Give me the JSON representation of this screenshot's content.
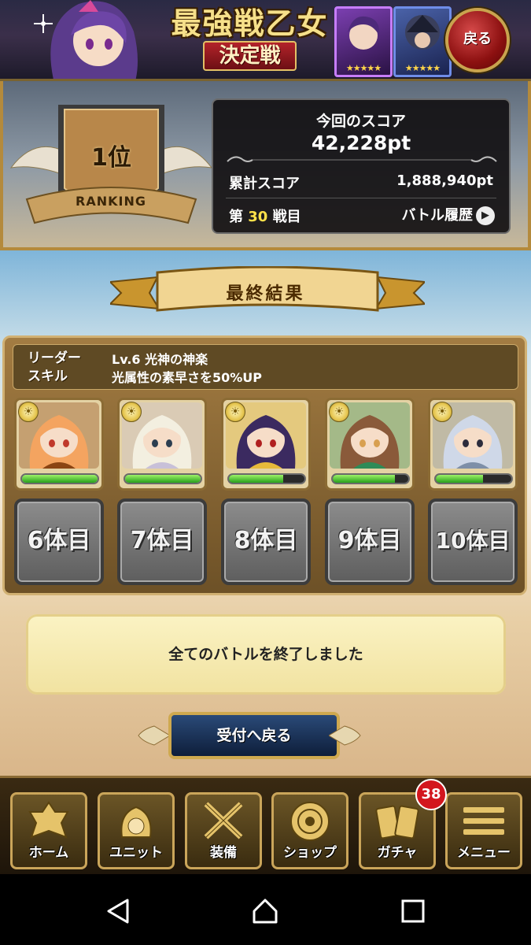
{
  "header": {
    "title_line1": "最強戦乙女",
    "title_line2": "決定戦",
    "back_label": "戻る",
    "card_stars": "★★★★★"
  },
  "rank": {
    "position": "1位",
    "emblem_label": "RANKING"
  },
  "score": {
    "title": "今回のスコア",
    "current": "42,228pt",
    "total_label": "累計スコア",
    "total_value": "1,888,940pt",
    "battle_prefix": "第",
    "battle_number": "30",
    "battle_suffix": "戦目",
    "history_label": "バトル履歴"
  },
  "result": {
    "ribbon_label": "最終結果"
  },
  "leader": {
    "label_line1": "リーダー",
    "label_line2": "スキル",
    "skill_name": "Lv.6 光神の神楽",
    "skill_desc": "光属性の素早さを50%UP"
  },
  "units": [
    {
      "hp": 1.0,
      "palette": [
        "#f4a460",
        "#8b4513",
        "#c0392b"
      ]
    },
    {
      "hp": 1.0,
      "palette": [
        "#f3efe0",
        "#c8c0d8",
        "#2c3e50"
      ]
    },
    {
      "hp": 0.72,
      "palette": [
        "#3b2a60",
        "#e6b93a",
        "#b02020"
      ]
    },
    {
      "hp": 0.82,
      "palette": [
        "#8a5a3a",
        "#2e8b57",
        "#d8a050"
      ]
    },
    {
      "hp": 0.62,
      "palette": [
        "#cfd8e8",
        "#7e8fa8",
        "#2c2c3c"
      ]
    }
  ],
  "slots": [
    "6体目",
    "7体目",
    "8体目",
    "9体目",
    "10体目"
  ],
  "message": "全てのバトルを終了しました",
  "return_button": "受付へ戻る",
  "nav": {
    "items": [
      {
        "label": "ホーム",
        "icon": "home-crest-icon"
      },
      {
        "label": "ユニット",
        "icon": "unit-helmet-icon"
      },
      {
        "label": "装備",
        "icon": "crossed-swords-icon"
      },
      {
        "label": "ショップ",
        "icon": "shop-medallion-icon"
      },
      {
        "label": "ガチャ",
        "icon": "gacha-cards-icon"
      },
      {
        "label": "メニュー",
        "icon": "menu-lines-icon"
      }
    ],
    "gacha_badge": "38"
  },
  "colors": {
    "gold": "#caa55a",
    "accent_red": "#d3161e",
    "hp_green": "#27a01b",
    "battle_number": "#ffe14a"
  }
}
